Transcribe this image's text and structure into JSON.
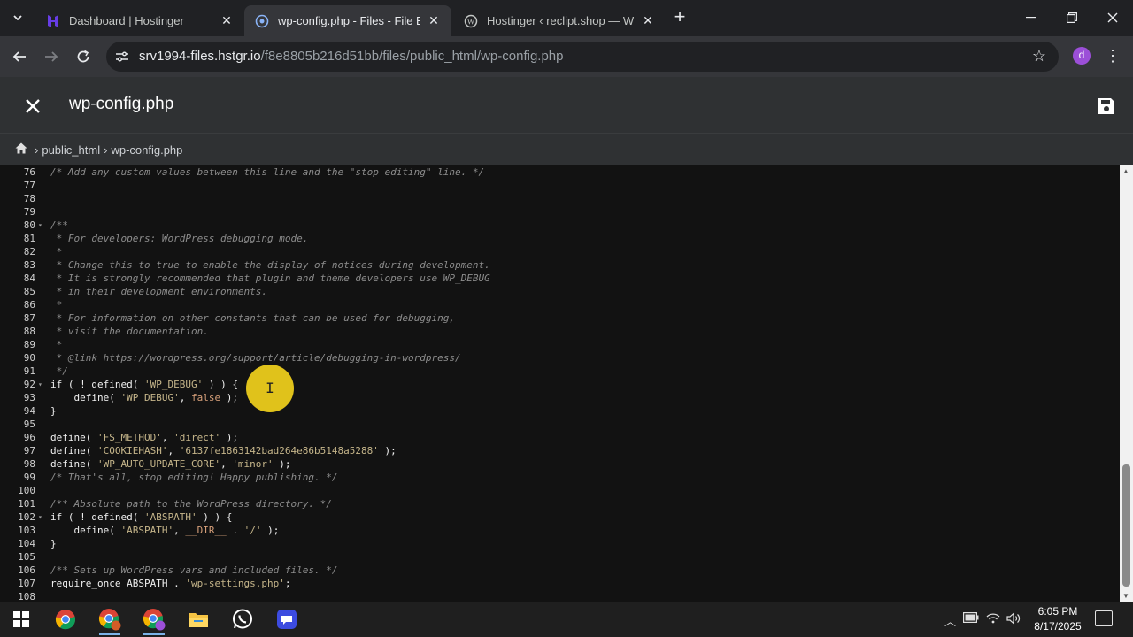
{
  "browser": {
    "tabs": [
      {
        "title": "Dashboard | Hostinger",
        "icon": "hostinger-icon",
        "active": false
      },
      {
        "title": "wp-config.php - Files - File Brow",
        "icon": "globe-icon",
        "active": true
      },
      {
        "title": "Hostinger ‹ reclipt.shop — Wor",
        "icon": "wordpress-icon",
        "active": false
      }
    ],
    "url_host": "srv1994-files.hstgr.io",
    "url_path": "/f8e8805b216d51bb/files/public_html/wp-config.php",
    "avatar_letter": "d",
    "accent": "#9c4fd8"
  },
  "editor": {
    "title": "wp-config.php",
    "breadcrumb": [
      "public_html",
      "wp-config.php"
    ]
  },
  "code_lines": [
    {
      "n": "76",
      "fold": false,
      "html": "<span class=\"cm\">/* Add any custom values between this line and the \"stop editing\" line. */</span>"
    },
    {
      "n": "77",
      "fold": false,
      "html": ""
    },
    {
      "n": "78",
      "fold": false,
      "html": ""
    },
    {
      "n": "79",
      "fold": false,
      "html": ""
    },
    {
      "n": "80",
      "fold": true,
      "html": "<span class=\"cm\">/**</span>"
    },
    {
      "n": "81",
      "fold": false,
      "html": "<span class=\"cm\"> * For developers: WordPress debugging mode.</span>"
    },
    {
      "n": "82",
      "fold": false,
      "html": "<span class=\"cm\"> *</span>"
    },
    {
      "n": "83",
      "fold": false,
      "html": "<span class=\"cm\"> * Change this to true to enable the display of notices during development.</span>"
    },
    {
      "n": "84",
      "fold": false,
      "html": "<span class=\"cm\"> * It is strongly recommended that plugin and theme developers use WP_DEBUG</span>"
    },
    {
      "n": "85",
      "fold": false,
      "html": "<span class=\"cm\"> * in their development environments.</span>"
    },
    {
      "n": "86",
      "fold": false,
      "html": "<span class=\"cm\"> *</span>"
    },
    {
      "n": "87",
      "fold": false,
      "html": "<span class=\"cm\"> * For information on other constants that can be used for debugging,</span>"
    },
    {
      "n": "88",
      "fold": false,
      "html": "<span class=\"cm\"> * visit the documentation.</span>"
    },
    {
      "n": "89",
      "fold": false,
      "html": "<span class=\"cm\"> *</span>"
    },
    {
      "n": "90",
      "fold": false,
      "html": "<span class=\"cm\"> * @link https://wordpress.org/support/article/debugging-in-wordpress/</span>"
    },
    {
      "n": "91",
      "fold": false,
      "html": "<span class=\"cm\"> */</span>"
    },
    {
      "n": "92",
      "fold": true,
      "html": "if ( ! defined( <span class=\"st\">'WP_DEBUG'</span> ) ) {"
    },
    {
      "n": "93",
      "fold": false,
      "html": "    define( <span class=\"st\">'WP_DEBUG'</span>, <span class=\"bool\">false</span> );"
    },
    {
      "n": "94",
      "fold": false,
      "html": "}"
    },
    {
      "n": "95",
      "fold": false,
      "html": ""
    },
    {
      "n": "96",
      "fold": false,
      "html": "define( <span class=\"st\">'FS_METHOD'</span>, <span class=\"st\">'direct'</span> );"
    },
    {
      "n": "97",
      "fold": false,
      "html": "define( <span class=\"st\">'COOKIEHASH'</span>, <span class=\"st\">'6137fe1863142bad264e86b5148a5288'</span> );"
    },
    {
      "n": "98",
      "fold": false,
      "html": "define( <span class=\"st\">'WP_AUTO_UPDATE_CORE'</span>, <span class=\"st\">'minor'</span> );"
    },
    {
      "n": "99",
      "fold": false,
      "html": "<span class=\"cm\">/* That's all, stop editing! Happy publishing. */</span>"
    },
    {
      "n": "100",
      "fold": false,
      "html": ""
    },
    {
      "n": "101",
      "fold": false,
      "html": "<span class=\"cm\">/** Absolute path to the WordPress directory. */</span>"
    },
    {
      "n": "102",
      "fold": true,
      "html": "if ( ! defined( <span class=\"st\">'ABSPATH'</span> ) ) {"
    },
    {
      "n": "103",
      "fold": false,
      "html": "    define( <span class=\"st\">'ABSPATH'</span>, <span class=\"bool\">__DIR__</span> . <span class=\"st\">'/'</span> );"
    },
    {
      "n": "104",
      "fold": false,
      "html": "}"
    },
    {
      "n": "105",
      "fold": false,
      "html": ""
    },
    {
      "n": "106",
      "fold": false,
      "html": "<span class=\"cm\">/** Sets up WordPress vars and included files. */</span>"
    },
    {
      "n": "107",
      "fold": false,
      "html": "require_once ABSPATH . <span class=\"st\">'wp-settings.php'</span>;"
    },
    {
      "n": "108",
      "fold": false,
      "html": ""
    }
  ],
  "taskbar": {
    "time": "6:05 PM",
    "date": "8/17/2025"
  }
}
